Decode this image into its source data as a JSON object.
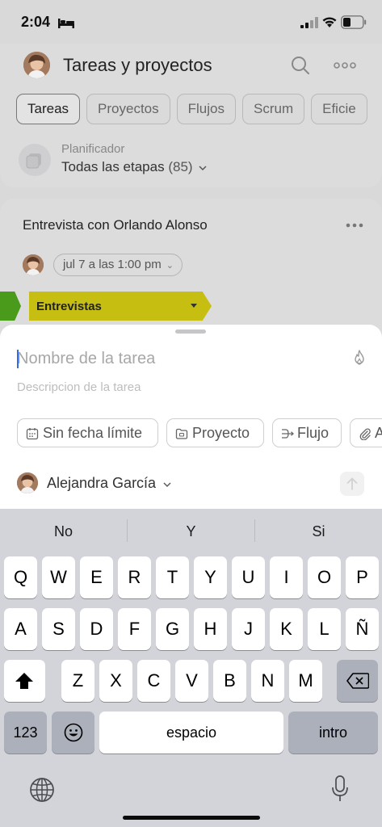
{
  "status_bar": {
    "time": "2:04",
    "icons": [
      "bed-icon",
      "signal-icon",
      "wifi-icon",
      "battery-icon"
    ]
  },
  "header": {
    "title": "Tareas y proyectos",
    "icons": [
      "search-icon",
      "more-icon"
    ],
    "tabs": [
      "Tareas",
      "Proyectos",
      "Flujos",
      "Scrum",
      "Eficie"
    ],
    "active_tab": "Tareas"
  },
  "planner": {
    "label": "Planificador",
    "value": "Todas las etapas",
    "count": "(85)"
  },
  "task_card": {
    "title": "Entrevista con Orlando Alonso",
    "date": "jul 7 a las 1:00 pm",
    "stage": "Entrevistas",
    "stage_color": "#c7be12",
    "prev_stage_color": "#4a9a1c"
  },
  "new_task_sheet": {
    "name_placeholder": "Nombre de la tarea",
    "name_value": "",
    "description_placeholder": "Descripcion de la tarea",
    "chips": {
      "deadline": "Sin fecha límite",
      "project": "Proyecto",
      "flow": "Flujo",
      "more": "A"
    },
    "assignee": "Alejandra García"
  },
  "keyboard": {
    "suggestions": [
      "No",
      "Y",
      "Si"
    ],
    "row1": [
      "Q",
      "W",
      "E",
      "R",
      "T",
      "Y",
      "U",
      "I",
      "O",
      "P"
    ],
    "row2": [
      "A",
      "S",
      "D",
      "F",
      "G",
      "H",
      "J",
      "K",
      "L",
      "Ñ"
    ],
    "row3": [
      "Z",
      "X",
      "C",
      "V",
      "B",
      "N",
      "M"
    ],
    "numbers_key": "123",
    "space_key": "espacio",
    "return_key": "intro"
  },
  "colors": {
    "accent_cursor": "#2f6de0",
    "sheet_bg": "#ffffff",
    "keyboard_bg": "#d2d4da"
  }
}
